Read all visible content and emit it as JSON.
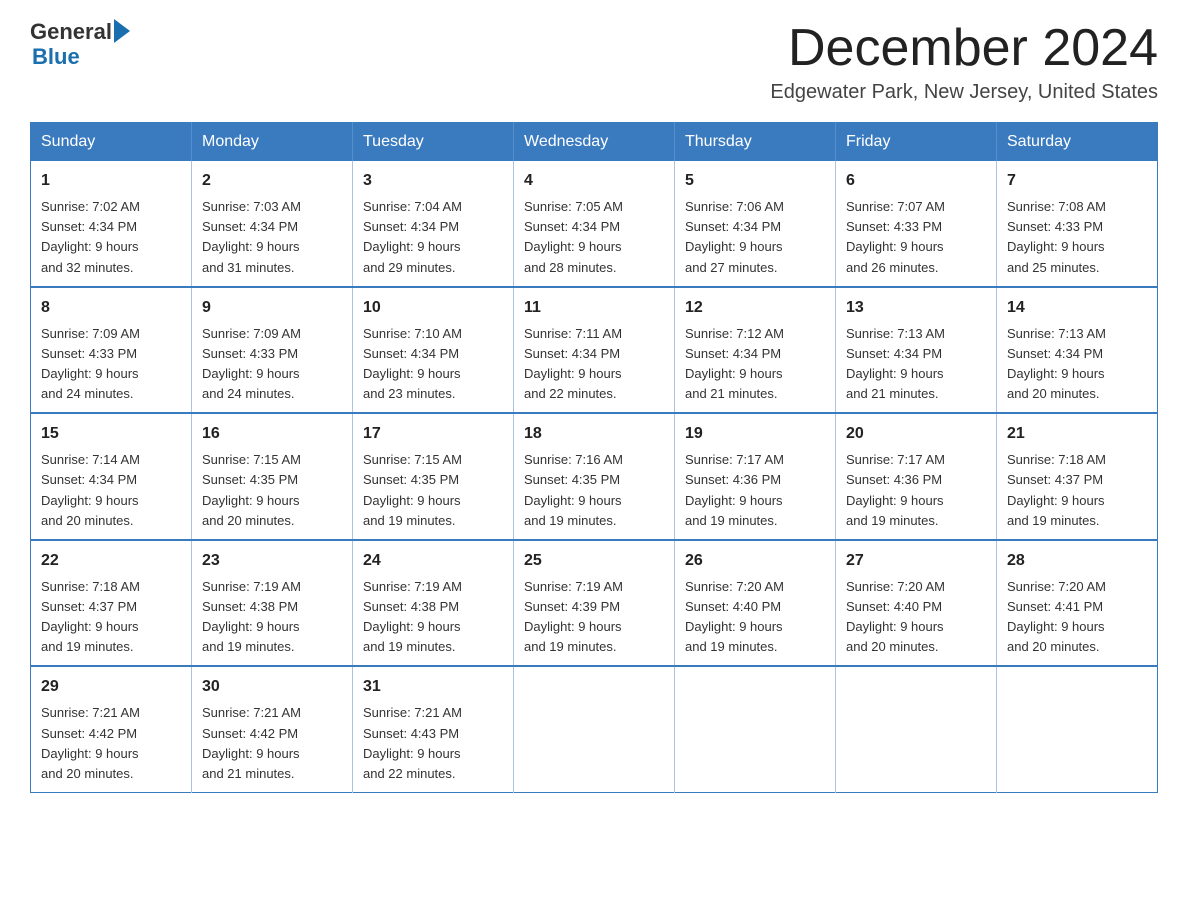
{
  "logo": {
    "line1": "General",
    "arrow": "▶",
    "line2": "Blue"
  },
  "header": {
    "month_title": "December 2024",
    "location": "Edgewater Park, New Jersey, United States"
  },
  "weekdays": [
    "Sunday",
    "Monday",
    "Tuesday",
    "Wednesday",
    "Thursday",
    "Friday",
    "Saturday"
  ],
  "weeks": [
    [
      {
        "day": "1",
        "sunrise": "7:02 AM",
        "sunset": "4:34 PM",
        "daylight": "9 hours and 32 minutes."
      },
      {
        "day": "2",
        "sunrise": "7:03 AM",
        "sunset": "4:34 PM",
        "daylight": "9 hours and 31 minutes."
      },
      {
        "day": "3",
        "sunrise": "7:04 AM",
        "sunset": "4:34 PM",
        "daylight": "9 hours and 29 minutes."
      },
      {
        "day": "4",
        "sunrise": "7:05 AM",
        "sunset": "4:34 PM",
        "daylight": "9 hours and 28 minutes."
      },
      {
        "day": "5",
        "sunrise": "7:06 AM",
        "sunset": "4:34 PM",
        "daylight": "9 hours and 27 minutes."
      },
      {
        "day": "6",
        "sunrise": "7:07 AM",
        "sunset": "4:33 PM",
        "daylight": "9 hours and 26 minutes."
      },
      {
        "day": "7",
        "sunrise": "7:08 AM",
        "sunset": "4:33 PM",
        "daylight": "9 hours and 25 minutes."
      }
    ],
    [
      {
        "day": "8",
        "sunrise": "7:09 AM",
        "sunset": "4:33 PM",
        "daylight": "9 hours and 24 minutes."
      },
      {
        "day": "9",
        "sunrise": "7:09 AM",
        "sunset": "4:33 PM",
        "daylight": "9 hours and 24 minutes."
      },
      {
        "day": "10",
        "sunrise": "7:10 AM",
        "sunset": "4:34 PM",
        "daylight": "9 hours and 23 minutes."
      },
      {
        "day": "11",
        "sunrise": "7:11 AM",
        "sunset": "4:34 PM",
        "daylight": "9 hours and 22 minutes."
      },
      {
        "day": "12",
        "sunrise": "7:12 AM",
        "sunset": "4:34 PM",
        "daylight": "9 hours and 21 minutes."
      },
      {
        "day": "13",
        "sunrise": "7:13 AM",
        "sunset": "4:34 PM",
        "daylight": "9 hours and 21 minutes."
      },
      {
        "day": "14",
        "sunrise": "7:13 AM",
        "sunset": "4:34 PM",
        "daylight": "9 hours and 20 minutes."
      }
    ],
    [
      {
        "day": "15",
        "sunrise": "7:14 AM",
        "sunset": "4:34 PM",
        "daylight": "9 hours and 20 minutes."
      },
      {
        "day": "16",
        "sunrise": "7:15 AM",
        "sunset": "4:35 PM",
        "daylight": "9 hours and 20 minutes."
      },
      {
        "day": "17",
        "sunrise": "7:15 AM",
        "sunset": "4:35 PM",
        "daylight": "9 hours and 19 minutes."
      },
      {
        "day": "18",
        "sunrise": "7:16 AM",
        "sunset": "4:35 PM",
        "daylight": "9 hours and 19 minutes."
      },
      {
        "day": "19",
        "sunrise": "7:17 AM",
        "sunset": "4:36 PM",
        "daylight": "9 hours and 19 minutes."
      },
      {
        "day": "20",
        "sunrise": "7:17 AM",
        "sunset": "4:36 PM",
        "daylight": "9 hours and 19 minutes."
      },
      {
        "day": "21",
        "sunrise": "7:18 AM",
        "sunset": "4:37 PM",
        "daylight": "9 hours and 19 minutes."
      }
    ],
    [
      {
        "day": "22",
        "sunrise": "7:18 AM",
        "sunset": "4:37 PM",
        "daylight": "9 hours and 19 minutes."
      },
      {
        "day": "23",
        "sunrise": "7:19 AM",
        "sunset": "4:38 PM",
        "daylight": "9 hours and 19 minutes."
      },
      {
        "day": "24",
        "sunrise": "7:19 AM",
        "sunset": "4:38 PM",
        "daylight": "9 hours and 19 minutes."
      },
      {
        "day": "25",
        "sunrise": "7:19 AM",
        "sunset": "4:39 PM",
        "daylight": "9 hours and 19 minutes."
      },
      {
        "day": "26",
        "sunrise": "7:20 AM",
        "sunset": "4:40 PM",
        "daylight": "9 hours and 19 minutes."
      },
      {
        "day": "27",
        "sunrise": "7:20 AM",
        "sunset": "4:40 PM",
        "daylight": "9 hours and 20 minutes."
      },
      {
        "day": "28",
        "sunrise": "7:20 AM",
        "sunset": "4:41 PM",
        "daylight": "9 hours and 20 minutes."
      }
    ],
    [
      {
        "day": "29",
        "sunrise": "7:21 AM",
        "sunset": "4:42 PM",
        "daylight": "9 hours and 20 minutes."
      },
      {
        "day": "30",
        "sunrise": "7:21 AM",
        "sunset": "4:42 PM",
        "daylight": "9 hours and 21 minutes."
      },
      {
        "day": "31",
        "sunrise": "7:21 AM",
        "sunset": "4:43 PM",
        "daylight": "9 hours and 22 minutes."
      },
      null,
      null,
      null,
      null
    ]
  ]
}
